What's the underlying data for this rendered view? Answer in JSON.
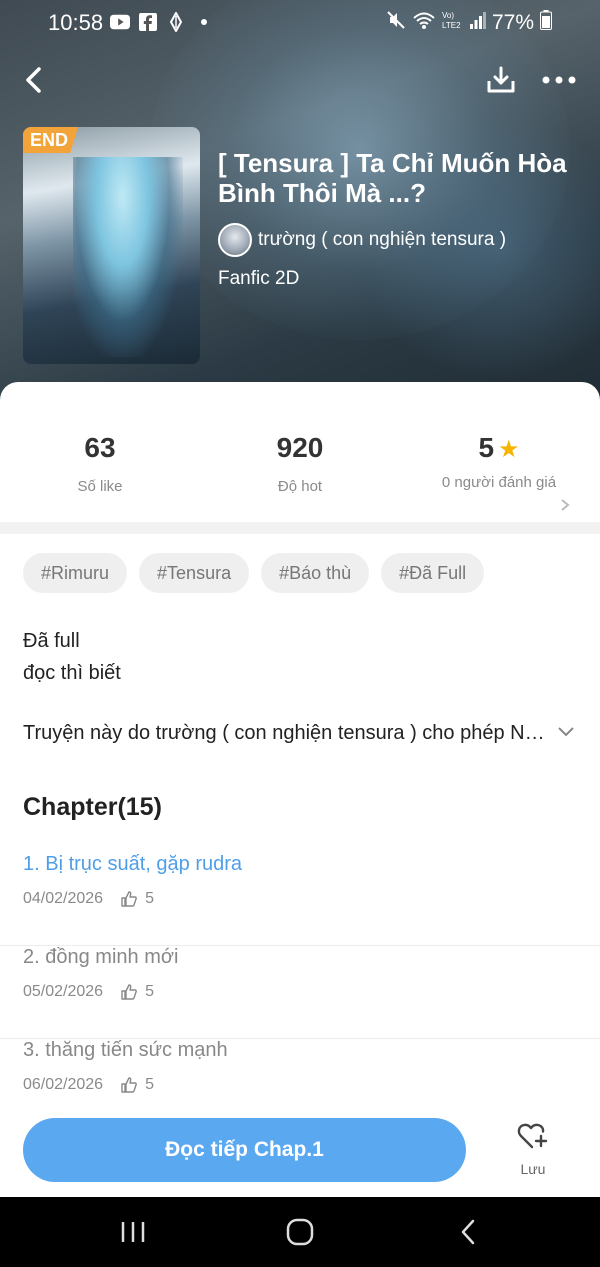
{
  "status_bar": {
    "time": "10:58",
    "battery": "77%"
  },
  "story": {
    "badge": "END",
    "title": "[ Tensura ] Ta Chỉ Muốn Hòa Bình Thôi Mà ...?",
    "author": "trường ( con nghiện tensura )",
    "category": "Fanfic 2D"
  },
  "stats": [
    {
      "value": "63",
      "label": "Số like"
    },
    {
      "value": "920",
      "label": "Độ hot"
    },
    {
      "value": "5",
      "label": "0 người đánh giá"
    }
  ],
  "tags": [
    "#Rimuru",
    "#Tensura",
    "#Báo thù",
    "#Đã Full"
  ],
  "description": {
    "line1": "Đã full",
    "line2": "đọc thì biết",
    "permission": "Truyện này do trường ( con nghiện tensura ) cho phép Nhà Của Truyện đăng tải"
  },
  "chapters": {
    "heading": "Chapter(15)",
    "items": [
      {
        "title": "1. Bị trục suất, gặp rudra",
        "date": "04/02/2026",
        "likes": "5"
      },
      {
        "title": "2. đồng minh mới",
        "date": "05/02/2026",
        "likes": "5"
      },
      {
        "title": "3. thăng tiến sức mạnh",
        "date": "06/02/2026",
        "likes": "5"
      }
    ]
  },
  "actions": {
    "read_label": "Đọc tiếp Chap.1",
    "save_label": "Lưu"
  },
  "colors": {
    "accent": "#5aa8ef",
    "active_chapter": "#4f9ee8",
    "badge": "#f2a33a",
    "star": "#f6b500"
  }
}
